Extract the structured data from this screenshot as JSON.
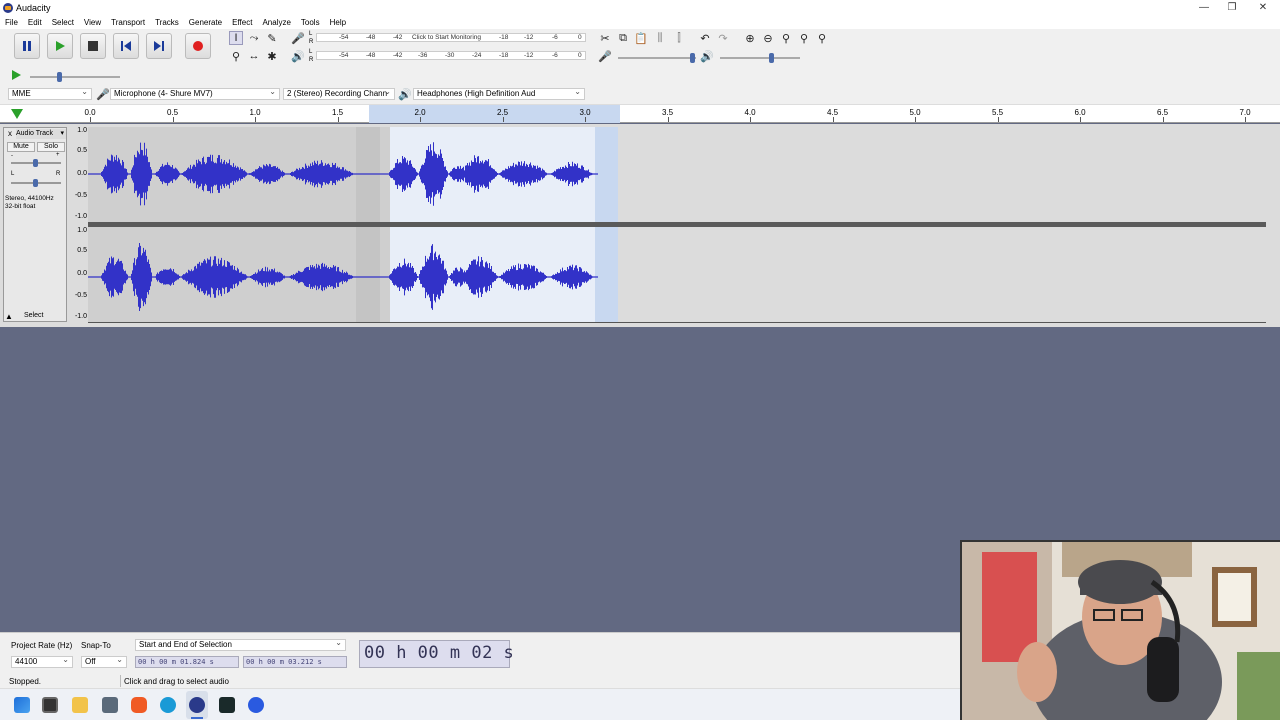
{
  "window": {
    "title": "Audacity"
  },
  "menu": [
    "File",
    "Edit",
    "Select",
    "View",
    "Transport",
    "Tracks",
    "Generate",
    "Effect",
    "Analyze",
    "Tools",
    "Help"
  ],
  "meters": {
    "record_scale": [
      "-54",
      "-48",
      "-42",
      "Click to Start Monitoring",
      "-18",
      "-12",
      "-6",
      "0"
    ],
    "play_scale": [
      "-54",
      "-48",
      "-42",
      "-36",
      "-30",
      "-24",
      "-18",
      "-12",
      "-6",
      "0"
    ],
    "record_channels": [
      "L",
      "R"
    ],
    "play_channels": [
      "L",
      "R"
    ]
  },
  "devices": {
    "host": "MME",
    "recording_device": "Microphone (4- Shure MV7)",
    "channels": "2 (Stereo) Recording Chann",
    "playback_device": "Headphones (High Definition Aud"
  },
  "timeline": {
    "ticks": [
      "0.0",
      "0.5",
      "1.0",
      "1.5",
      "2.0",
      "2.5",
      "3.0",
      "3.5",
      "4.0",
      "4.5",
      "5.0",
      "5.5",
      "6.0",
      "6.5",
      "7.0"
    ],
    "selection_start_sec": 1.824,
    "selection_end_sec": 3.212
  },
  "track": {
    "name": "Audio Track",
    "close_symbol": "x",
    "mute_label": "Mute",
    "solo_label": "Solo",
    "gain_minus": "-",
    "gain_plus": "+",
    "pan_left": "L",
    "pan_right": "R",
    "info_line1": "Stereo, 44100Hz",
    "info_line2": "32-bit float",
    "select_label": "Select",
    "vscale": [
      "1.0",
      "0.5",
      "0.0",
      "-0.5",
      "-1.0"
    ]
  },
  "bottom": {
    "project_rate_label": "Project Rate (Hz)",
    "snap_to_label": "Snap-To",
    "project_rate_value": "44100",
    "snap_to_value": "Off",
    "selection_mode": "Start and End of Selection",
    "selection_start": "00 h 00 m 01.824 s",
    "selection_end": "00 h 00 m 03.212 s",
    "audio_position": "00 h 00 m 02 s"
  },
  "status": {
    "state": "Stopped.",
    "hint": "Click and drag to select audio"
  },
  "colors": {
    "waveform": "#3232c8",
    "background": "#626982",
    "record": "#e02020",
    "play": "#2aa02a"
  }
}
